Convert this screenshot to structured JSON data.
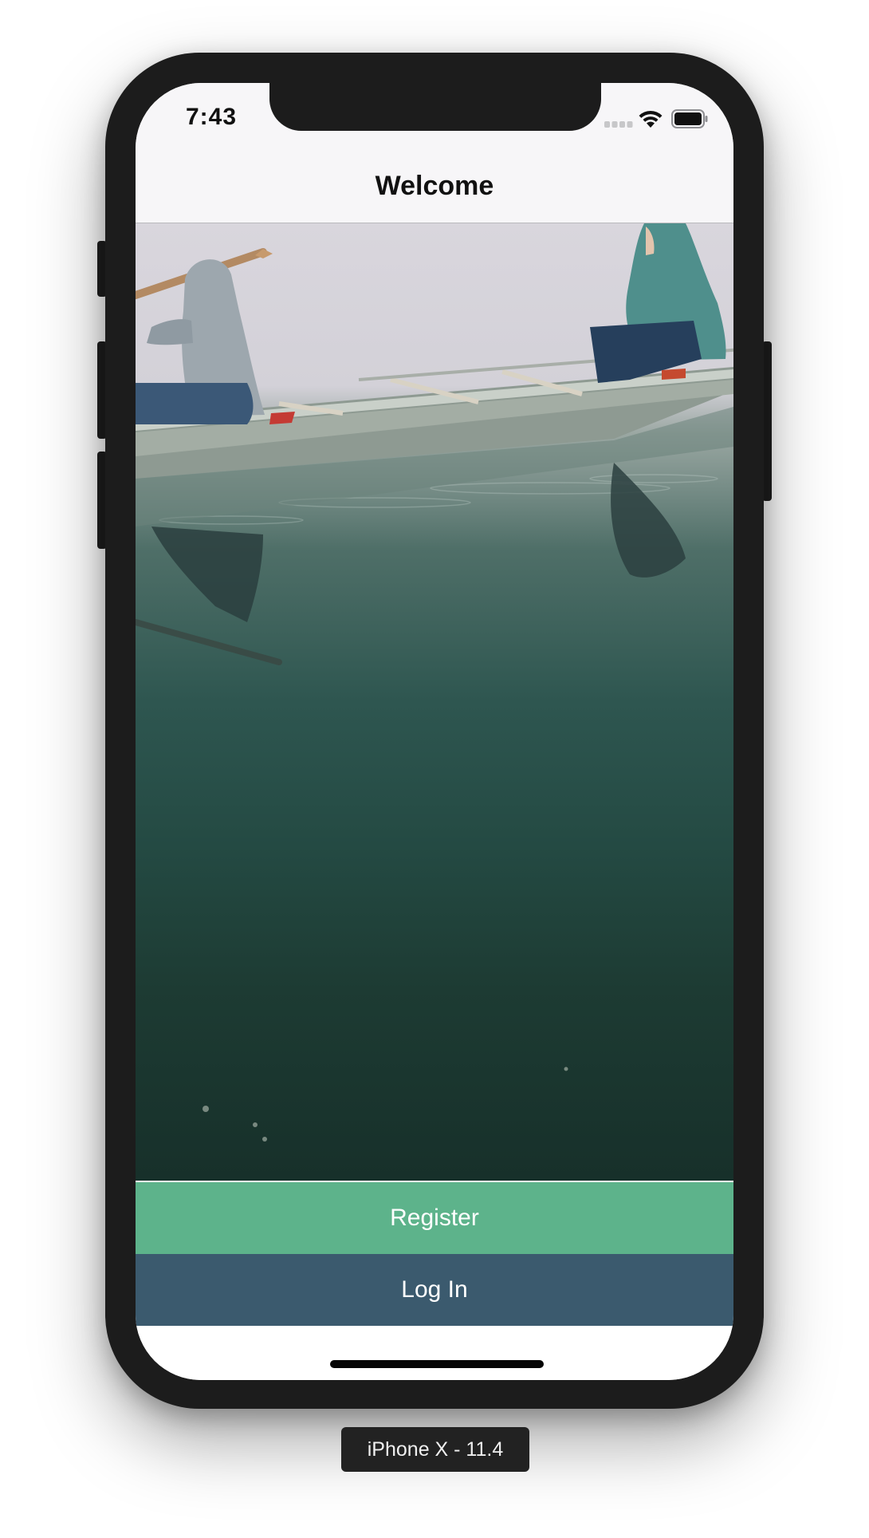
{
  "status_bar": {
    "time": "7:43",
    "icons": [
      "signal-icon",
      "wifi-icon",
      "battery-icon"
    ]
  },
  "navigation": {
    "title": "Welcome"
  },
  "hero": {
    "description_icon": "hero-photo"
  },
  "buttons": {
    "register_label": "Register",
    "login_label": "Log In"
  },
  "simulator": {
    "label": "iPhone X - 11.4"
  },
  "colors": {
    "register": "#5db38b",
    "login": "#3b5a6e",
    "device_frame": "#1c1c1c",
    "navbar": "#f7f6f8"
  }
}
